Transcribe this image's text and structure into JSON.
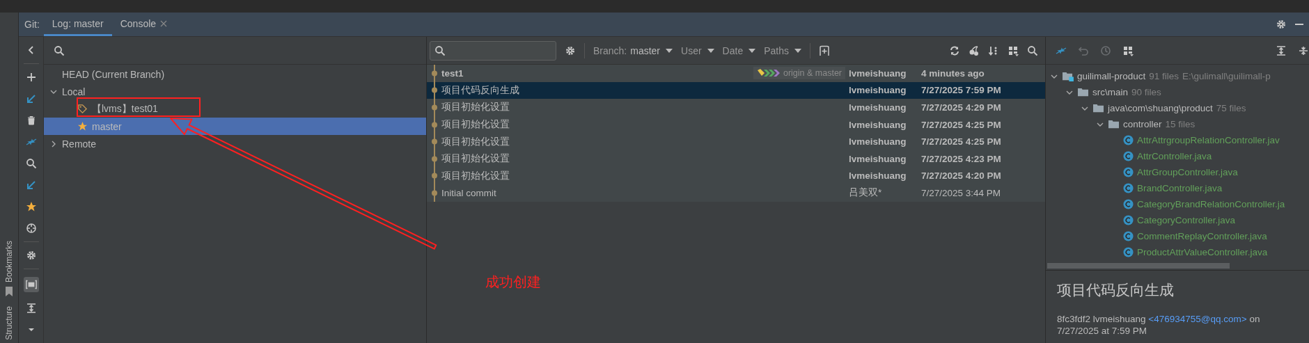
{
  "side_strip": {
    "items": [
      {
        "label": "Bookmarks",
        "kind": "bookmark"
      },
      {
        "label": "Structure",
        "kind": "plain"
      }
    ]
  },
  "git_panel": {
    "label": "Git:",
    "tabs": [
      {
        "label": "Log: master",
        "selected": true,
        "closable": false
      },
      {
        "label": "Console",
        "selected": false,
        "closable": true
      }
    ]
  },
  "branches": {
    "tree": [
      {
        "label": "HEAD (Current Branch)",
        "kind": "head",
        "selected": false
      },
      {
        "label": "Local",
        "kind": "group",
        "expanded": true,
        "selected": false,
        "children": [
          {
            "label": "【lvms】test01",
            "kind": "tag",
            "selected": false
          },
          {
            "label": "master",
            "kind": "star",
            "selected": true
          }
        ]
      },
      {
        "label": "Remote",
        "kind": "group",
        "expanded": false,
        "selected": false
      }
    ]
  },
  "log": {
    "filters": [
      {
        "label": "Branch:",
        "value": "master"
      },
      {
        "label": "User"
      },
      {
        "label": "Date"
      },
      {
        "label": "Paths"
      }
    ],
    "commits": [
      {
        "subject": "test1",
        "refs": "origin & master",
        "author": "lvmeishuang",
        "date": "4 minutes ago",
        "bold": true,
        "selected": false
      },
      {
        "subject": "项目代码反向生成",
        "author": "lvmeishuang",
        "date": "7/27/2025 7:59 PM",
        "bold": true,
        "selected": true
      },
      {
        "subject": "项目初始化设置",
        "author": "lvmeishuang",
        "date": "7/27/2025 4:29 PM",
        "bold": true,
        "selected": false
      },
      {
        "subject": "项目初始化设置",
        "author": "lvmeishuang",
        "date": "7/27/2025 4:25 PM",
        "bold": true,
        "selected": false
      },
      {
        "subject": "项目初始化设置",
        "author": "lvmeishuang",
        "date": "7/27/2025 4:25 PM",
        "bold": true,
        "selected": false
      },
      {
        "subject": "项目初始化设置",
        "author": "lvmeishuang",
        "date": "7/27/2025 4:23 PM",
        "bold": true,
        "selected": false
      },
      {
        "subject": "项目初始化设置",
        "author": "lvmeishuang",
        "date": "7/27/2025 4:20 PM",
        "bold": true,
        "selected": false
      },
      {
        "subject": "Initial commit",
        "author": "吕美双*",
        "date": "7/27/2025 3:44 PM",
        "bold": false,
        "selected": false
      }
    ]
  },
  "changes": {
    "tree": [
      {
        "label": "guilimall-product",
        "kind": "module",
        "count": "91 files",
        "path": "E:\\gulimall\\guilimall-p",
        "expanded": true,
        "children": [
          {
            "label": "src\\main",
            "kind": "folder",
            "count": "90 files",
            "expanded": true,
            "children": [
              {
                "label": "java\\com\\shuang\\product",
                "kind": "folder",
                "count": "75 files",
                "expanded": true,
                "children": [
                  {
                    "label": "controller",
                    "kind": "folder",
                    "count": "15 files",
                    "expanded": true,
                    "children": [
                      {
                        "label": "AttrAttrgroupRelationController.jav",
                        "kind": "class"
                      },
                      {
                        "label": "AttrController.java",
                        "kind": "class"
                      },
                      {
                        "label": "AttrGroupController.java",
                        "kind": "class"
                      },
                      {
                        "label": "BrandController.java",
                        "kind": "class"
                      },
                      {
                        "label": "CategoryBrandRelationController.ja",
                        "kind": "class"
                      },
                      {
                        "label": "CategoryController.java",
                        "kind": "class"
                      },
                      {
                        "label": "CommentReplayController.java",
                        "kind": "class"
                      },
                      {
                        "label": "ProductAttrValueController.java",
                        "kind": "class"
                      }
                    ]
                  }
                ]
              }
            ]
          }
        ]
      }
    ],
    "details": {
      "title": "项目代码反向生成",
      "hash": "8fc3fdf2",
      "author": "lvmeishuang",
      "email": "<476934755@qq.com>",
      "on": "on",
      "date": "7/27/2025 at 7:59 PM"
    }
  },
  "annotation": {
    "text": "成功创建"
  }
}
